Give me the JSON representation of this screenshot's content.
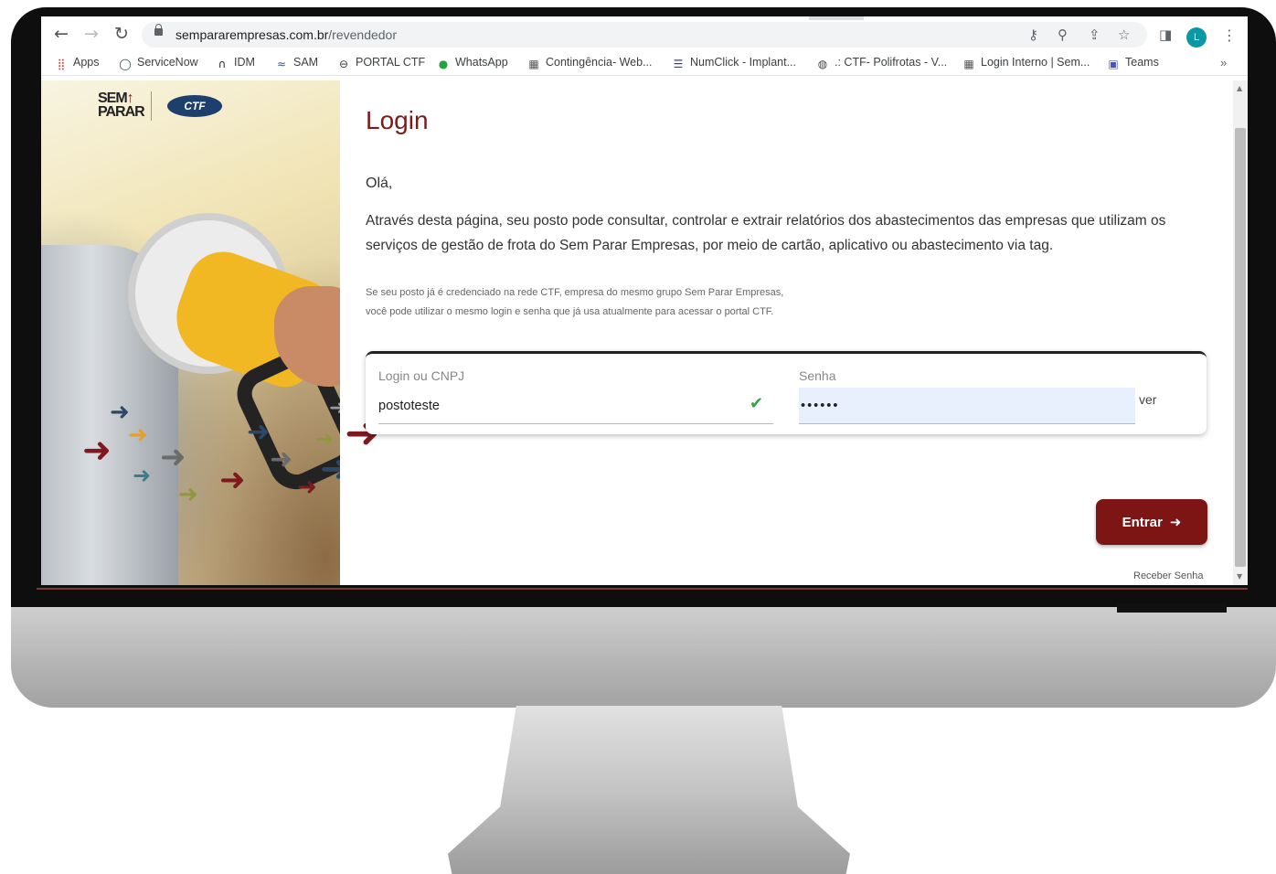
{
  "browser": {
    "url_domain": "sempararempresas.com.br",
    "url_path": "/revendedor",
    "profile_initial": "L",
    "bookmarks": [
      {
        "label": "Apps",
        "icon": "apps-grid-icon"
      },
      {
        "label": "ServiceNow",
        "icon": "servicenow-icon"
      },
      {
        "label": "IDM",
        "icon": "idm-icon"
      },
      {
        "label": "SAM",
        "icon": "sam-icon"
      },
      {
        "label": "PORTAL CTF",
        "icon": "portal-ctf-icon"
      },
      {
        "label": "WhatsApp",
        "icon": "whatsapp-icon"
      },
      {
        "label": "Contingência- Web...",
        "icon": "site-icon"
      },
      {
        "label": "NumClick - Implant...",
        "icon": "list-icon"
      },
      {
        "label": ".: CTF- Polifrotas - V...",
        "icon": "globe-icon"
      },
      {
        "label": "Login Interno | Sem...",
        "icon": "site-icon"
      },
      {
        "label": "Teams",
        "icon": "teams-icon"
      }
    ],
    "more": "»"
  },
  "brand": {
    "logo_line1": "SEM",
    "logo_line2": "PARAR",
    "ctf": "CTF"
  },
  "login": {
    "title": "Login",
    "greeting": "Olá,",
    "description": "Através desta página, seu posto pode consultar, controlar e extrair relatórios dos abastecimentos das empresas que utilizam os serviços de gestão de frota do Sem Parar Empresas, por meio de cartão, aplicativo ou abastecimento via tag.",
    "note_line1": "Se seu posto já é credenciado na rede CTF, empresa do mesmo grupo Sem Parar Empresas,",
    "note_line2": "você pode utilizar o mesmo login e senha que já usa atualmente para acessar o portal CTF.",
    "login_label": "Login ou CNPJ",
    "login_value": "postoteste",
    "password_label": "Senha",
    "password_value": "••••••",
    "show_password": "ver",
    "submit": "Entrar",
    "receive_password": "Receber Senha"
  },
  "colors": {
    "brand_red": "#7e1515",
    "input_highlight": "#e8f0fe",
    "valid_green": "#3aa04b"
  }
}
